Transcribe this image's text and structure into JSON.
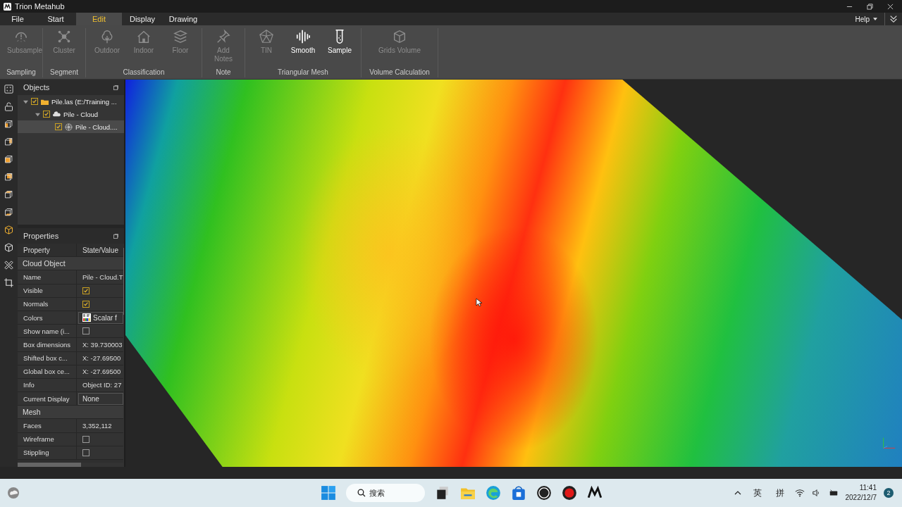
{
  "window": {
    "title": "Trion Metahub"
  },
  "menu_tabs": [
    {
      "label": "File",
      "selected": false
    },
    {
      "label": "Start",
      "selected": false
    },
    {
      "label": "Edit",
      "selected": true
    },
    {
      "label": "Display",
      "selected": false
    },
    {
      "label": "Drawing",
      "selected": false
    }
  ],
  "help_menu": {
    "label": "Help"
  },
  "ribbon": [
    {
      "label": "Sampling",
      "tools": [
        {
          "label": "Subsample",
          "disabled": true
        }
      ]
    },
    {
      "label": "Segment",
      "tools": [
        {
          "label": "Cluster",
          "disabled": true
        }
      ]
    },
    {
      "label": "Classification",
      "tools": [
        {
          "label": "Outdoor",
          "disabled": true
        },
        {
          "label": "Indoor",
          "disabled": true
        },
        {
          "label": "Floor",
          "disabled": true
        }
      ]
    },
    {
      "label": "Note",
      "tools": [
        {
          "label": "Add Notes",
          "disabled": true
        }
      ]
    },
    {
      "label": "Triangular Mesh",
      "tools": [
        {
          "label": "TIN",
          "disabled": true
        },
        {
          "label": "Smooth",
          "disabled": false
        },
        {
          "label": "Sample",
          "disabled": false
        }
      ]
    },
    {
      "label": "Volume Calculation",
      "tools": [
        {
          "label": "Grids Volume",
          "disabled": true
        }
      ]
    }
  ],
  "objects": {
    "title": "Objects",
    "tree": [
      {
        "label": "Pile.las (E:/Training ...",
        "checked": true,
        "expanded": true,
        "selected": false,
        "children": [
          {
            "label": "Pile - Cloud",
            "checked": true,
            "expanded": true,
            "selected": false,
            "children": [
              {
                "label": "Pile - Cloud....",
                "checked": true,
                "selected": true
              }
            ]
          }
        ]
      }
    ]
  },
  "properties": {
    "title": "Properties",
    "columns": [
      "Property",
      "State/Value"
    ],
    "rows": [
      {
        "kind": "section",
        "label": "Cloud Object"
      },
      {
        "kind": "text",
        "label": "Name",
        "value": "Pile - Cloud.T"
      },
      {
        "kind": "checkbox",
        "label": "Visible",
        "checked": true
      },
      {
        "kind": "checkbox",
        "label": "Normals",
        "checked": true
      },
      {
        "kind": "scalar",
        "label": "Colors",
        "value": "Scalar f"
      },
      {
        "kind": "checkbox",
        "label": "Show name (i...",
        "checked": false
      },
      {
        "kind": "text",
        "label": "Box dimensions",
        "value": "X: 39.730003"
      },
      {
        "kind": "text",
        "label": "Shifted box c...",
        "value": "X: -27.69500"
      },
      {
        "kind": "text",
        "label": "Global box ce...",
        "value": "X: -27.69500"
      },
      {
        "kind": "text",
        "label": "Info",
        "value": "Object ID: 27"
      },
      {
        "kind": "select",
        "label": "Current Display",
        "value": "None"
      },
      {
        "kind": "section",
        "label": "Mesh"
      },
      {
        "kind": "text",
        "label": "Faces",
        "value": "3,352,112"
      },
      {
        "kind": "checkbox",
        "label": "Wireframe",
        "checked": false
      },
      {
        "kind": "checkbox",
        "label": "Stippling",
        "checked": false
      }
    ]
  },
  "taskbar": {
    "search": {
      "placeholder": "搜索"
    },
    "ime": [
      "英",
      "拼"
    ],
    "time": "11:41",
    "date": "2022/12/7",
    "notifications": "2"
  }
}
